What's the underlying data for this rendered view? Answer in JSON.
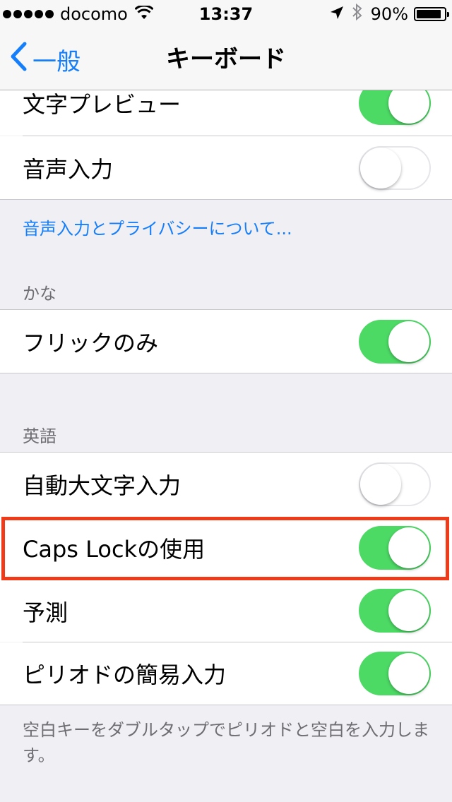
{
  "status_bar": {
    "carrier": "docomo",
    "time": "13:37",
    "battery": "90%",
    "icons": [
      "signal-dots",
      "wifi-icon",
      "location-icon",
      "bluetooth-icon",
      "battery-icon"
    ]
  },
  "nav": {
    "back_label": "一般",
    "title": "キーボード"
  },
  "sections": {
    "top_items": [
      {
        "label": "文字プレビュー",
        "on": true
      },
      {
        "label": "音声入力",
        "on": false
      }
    ],
    "privacy_link": "音声入力とプライバシーについて...",
    "kana_header": "かな",
    "kana_items": [
      {
        "label": "フリックのみ",
        "on": true
      }
    ],
    "english_header": "英語",
    "english_items": [
      {
        "label": "自動大文字入力",
        "on": false
      },
      {
        "label": "Caps Lockの使用",
        "on": true
      },
      {
        "label": "予測",
        "on": true
      },
      {
        "label": "ピリオドの簡易入力",
        "on": true
      }
    ],
    "footer_note": "空白キーをダブルタップでピリオドと空白を入力します。"
  },
  "colors": {
    "toggle_on": "#4cd964",
    "tint": "#157efb",
    "highlight": "#ee3b19"
  }
}
